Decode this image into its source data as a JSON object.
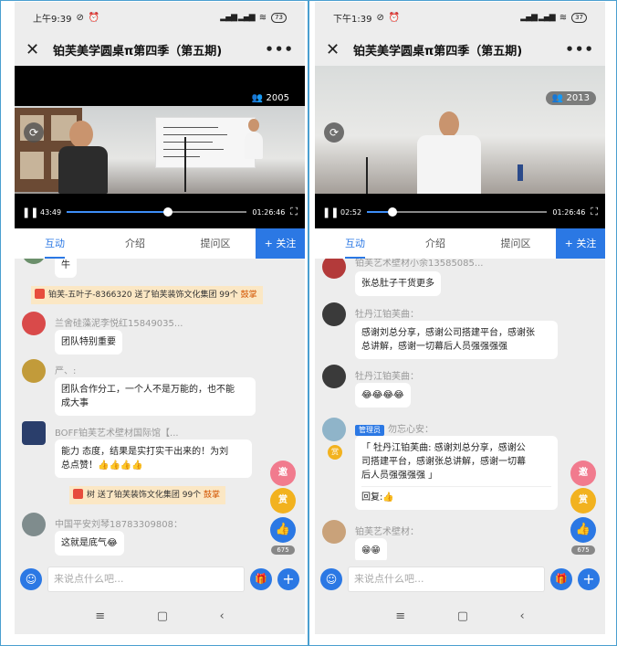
{
  "left": {
    "status": {
      "time": "上午9:39",
      "battery": "73"
    },
    "title": "铂芙美学圆桌π第四季（第五期)",
    "video": {
      "viewers": "2005",
      "current_time": "43:49",
      "duration": "01:26:46",
      "progress": 0.56
    },
    "tabs": [
      "互动",
      "介绍",
      "提问区"
    ],
    "follow": "+ 关注",
    "messages": [
      {
        "name": "",
        "text": "牛"
      },
      {
        "gift": "铂芙-五叶子-8366320 送了铂芙装饰文化集团 99个 ",
        "gift_action": "鼓掌"
      },
      {
        "name": "兰舍硅藻泥李悦红15849035...",
        "text": "团队特别重要"
      },
      {
        "name": "严、:",
        "text_lines": [
          "团队合作分工，一个人不是万能的，也不能",
          "成大事"
        ]
      },
      {
        "name": "BOFF铂芙艺术壁材国际馆【...",
        "text_lines": [
          "能力 态度，结果是实打实干出来的！为刘",
          "总点赞！👍👍👍👍"
        ]
      },
      {
        "gift": "树 送了铂芙装饰文化集团 99个 ",
        "gift_action": "鼓掌"
      },
      {
        "name": "中国平安刘琴18783309808：",
        "text": "这就是底气😂"
      }
    ],
    "side": {
      "invite": "邀",
      "reward": "赏",
      "likes": "675"
    },
    "input_placeholder": "来说点什么吧..."
  },
  "right": {
    "status": {
      "time": "下午1:39",
      "battery": "37"
    },
    "title": "铂芙美学圆桌π第四季（第五期)",
    "video": {
      "viewers": "2013",
      "current_time": "02:52",
      "duration": "01:26:46",
      "progress": 0.14
    },
    "tabs": [
      "互动",
      "介绍",
      "提问区"
    ],
    "follow": "+ 关注",
    "messages": [
      {
        "name": "铂芙艺术壁材小余13585085...",
        "text": "张总肚子干货更多"
      },
      {
        "name": "牡丹江铂芙曲：",
        "text_lines": [
          "感谢刘总分享，感谢公司搭建平台，感谢张",
          "总讲解，感谢一切幕后人员强强强强"
        ]
      },
      {
        "name": "牡丹江铂芙曲：",
        "text": "😂😂😂😂"
      },
      {
        "badge": "管理员",
        "name": "勿忘心安：",
        "text_lines": [
          "「 牡丹江铂芙曲: 感谢刘总分享，感谢公",
          "司搭建平台，感谢张总讲解，感谢一切幕",
          "后人员强强强强 」"
        ],
        "reply": "回复:👍"
      },
      {
        "name": "铂芙艺术壁材：",
        "text": "😁😁"
      }
    ],
    "side": {
      "invite": "邀",
      "reward": "赏",
      "likes": "675"
    },
    "input_placeholder": "来说点什么吧..."
  }
}
